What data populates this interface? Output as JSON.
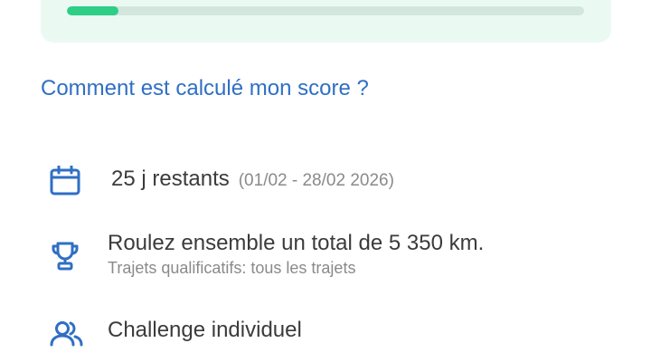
{
  "progress": {
    "fraction": 0.1,
    "track_color": "#d3e6de",
    "fill_color": "#2ccf85",
    "card_color": "#eafaf3"
  },
  "score_link": {
    "label": "Comment est calculé mon score ?",
    "color": "#2f6fc4"
  },
  "details": {
    "remaining": {
      "icon": "calendar-icon",
      "label": "25 j restants",
      "period": "(01/02 - 28/02 2026)"
    },
    "goal": {
      "icon": "trophy-icon",
      "label": "Roulez ensemble un total de 5 350 km.",
      "qualifying": "Trajets qualificatifs: tous les trajets"
    },
    "type": {
      "icon": "users-icon",
      "label": "Challenge individuel"
    }
  },
  "icon_color": "#2f6fc4"
}
